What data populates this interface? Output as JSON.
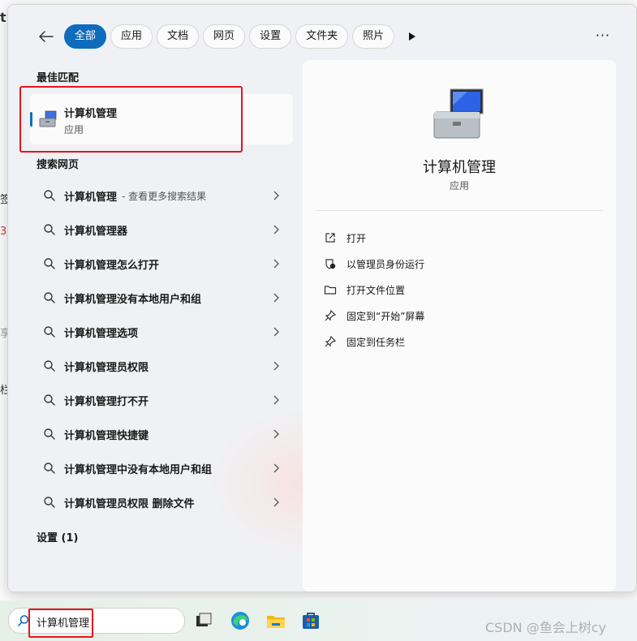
{
  "filters": {
    "active": "全部",
    "chips": [
      "全部",
      "应用",
      "文档",
      "网页",
      "设置",
      "文件夹",
      "照片"
    ]
  },
  "best_match": {
    "section_label": "最佳匹配",
    "app_name": "计算机管理",
    "app_type": "应用"
  },
  "web_search": {
    "section_label": "搜索网页",
    "results": [
      {
        "text": "计算机管理",
        "sub": "- 查看更多搜索结果"
      },
      {
        "text": "计算机管理器",
        "sub": ""
      },
      {
        "text": "计算机管理怎么打开",
        "sub": ""
      },
      {
        "text": "计算机管理没有本地用户和组",
        "sub": ""
      },
      {
        "text": "计算机管理选项",
        "sub": ""
      },
      {
        "text": "计算机管理员权限",
        "sub": ""
      },
      {
        "text": "计算机管理打不开",
        "sub": ""
      },
      {
        "text": "计算机管理快捷键",
        "sub": ""
      },
      {
        "text": "计算机管理中没有本地用户和组",
        "sub": ""
      },
      {
        "text": "计算机管理员权限 删除文件",
        "sub": ""
      }
    ]
  },
  "settings_section": {
    "label": "设置 (1)"
  },
  "preview": {
    "app_name": "计算机管理",
    "app_type": "应用",
    "actions": [
      {
        "label": "打开",
        "icon": "open-external-icon"
      },
      {
        "label": "以管理员身份运行",
        "icon": "shield-icon"
      },
      {
        "label": "打开文件位置",
        "icon": "folder-icon"
      },
      {
        "label": "固定到“开始”屏幕",
        "icon": "pin-icon"
      },
      {
        "label": "固定到任务栏",
        "icon": "pin-icon"
      }
    ]
  },
  "taskbar": {
    "search_query": "计算机管理",
    "watermark": "CSDN @鱼会上树cy"
  },
  "background_fragments": [
    "t",
    "签",
    "3",
    "享",
    "栏"
  ],
  "colors": {
    "accent": "#0f6cbd",
    "highlight_box": "#e8141b"
  }
}
